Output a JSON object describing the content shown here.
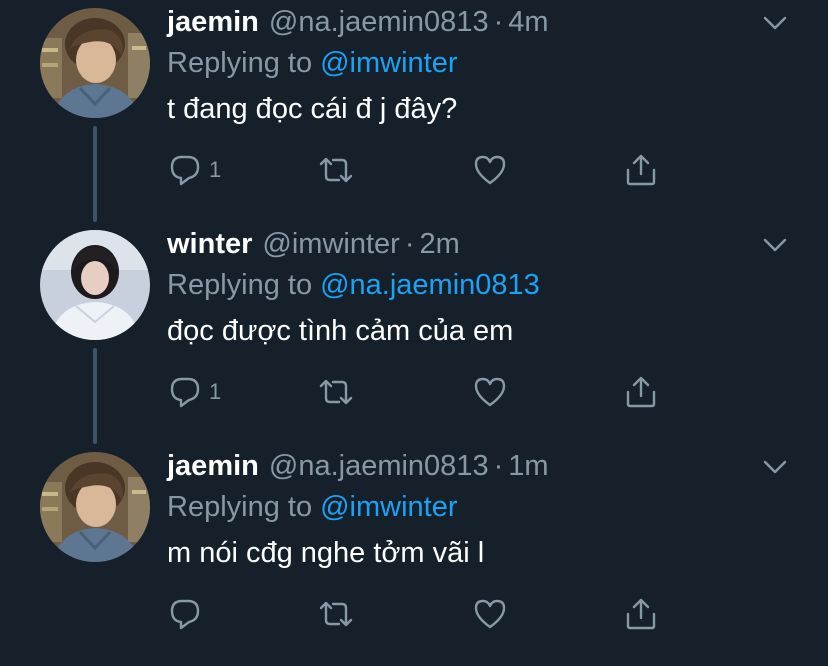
{
  "colors": {
    "background": "#15202b",
    "text_primary": "#ffffff",
    "text_secondary": "#8899a6",
    "link": "#1da1f2",
    "thread_line": "#3d5466"
  },
  "tweets": [
    {
      "name": "jaemin",
      "handle": "@na.jaemin0813",
      "separator": "·",
      "time": "4m",
      "replying_prefix": "Replying to",
      "replying_to": "@imwinter",
      "text": "t đang đọc cái đ j đây?",
      "reply_count": "1",
      "avatar": "jaemin-avatar"
    },
    {
      "name": "winter",
      "handle": "@imwinter",
      "separator": "·",
      "time": "2m",
      "replying_prefix": "Replying to",
      "replying_to": "@na.jaemin0813",
      "text": "đọc được tình cảm của em",
      "reply_count": "1",
      "avatar": "winter-avatar"
    },
    {
      "name": "jaemin",
      "handle": "@na.jaemin0813",
      "separator": "·",
      "time": "1m",
      "replying_prefix": "Replying to",
      "replying_to": "@imwinter",
      "text": "m nói cđg nghe tởm vãi l",
      "reply_count": "",
      "avatar": "jaemin-avatar"
    }
  ],
  "icons": {
    "reply": "reply-icon",
    "retweet": "retweet-icon",
    "like": "heart-icon",
    "share": "share-icon",
    "menu": "chevron-down-icon"
  }
}
